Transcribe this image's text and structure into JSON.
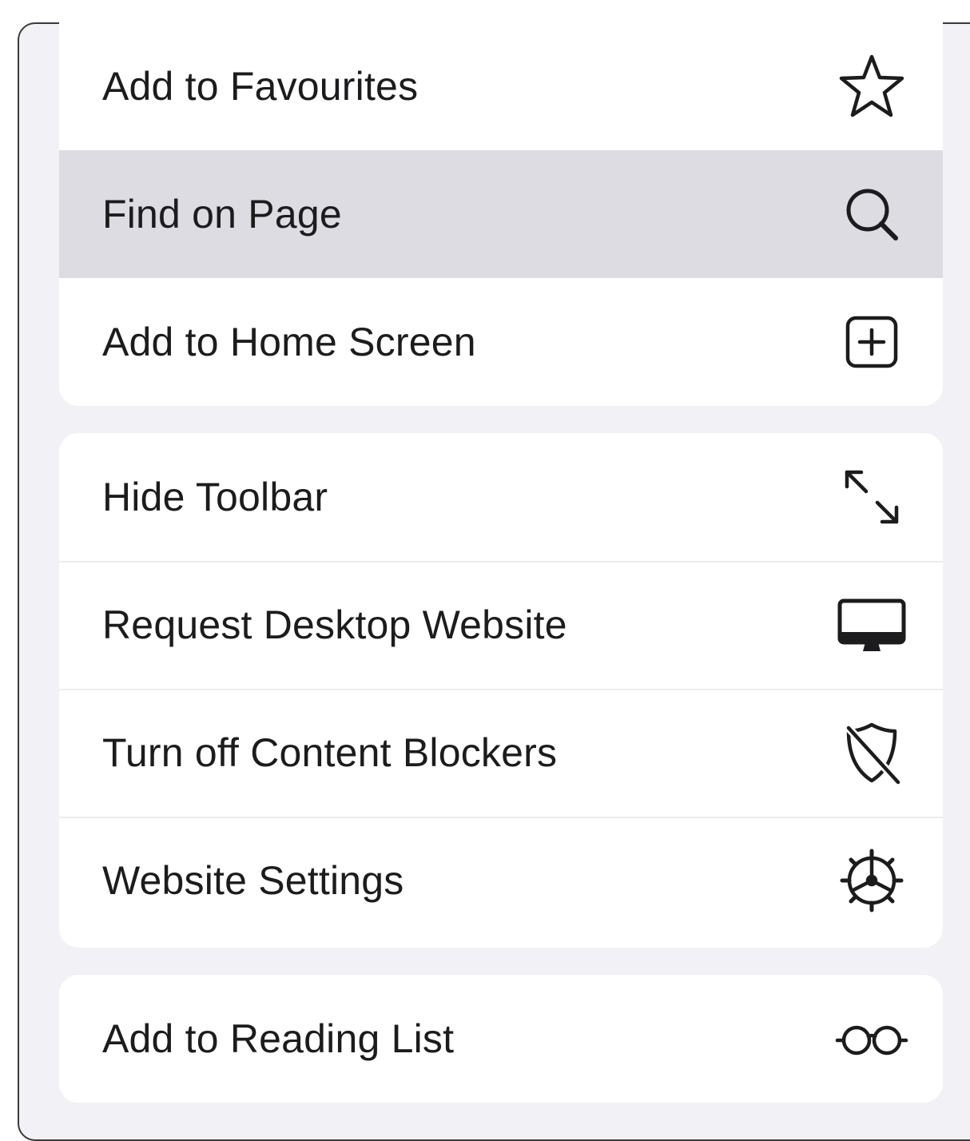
{
  "menu": {
    "groups": [
      {
        "items": [
          {
            "label": "Add to Favourites",
            "icon": "star-icon"
          },
          {
            "label": "Find on Page",
            "icon": "search-icon",
            "highlighted": true
          },
          {
            "label": "Add to Home Screen",
            "icon": "plus-square-icon"
          }
        ]
      },
      {
        "items": [
          {
            "label": "Hide Toolbar",
            "icon": "resize-arrows-icon"
          },
          {
            "label": "Request Desktop Website",
            "icon": "desktop-icon"
          },
          {
            "label": "Turn off Content Blockers",
            "icon": "shield-slash-icon"
          },
          {
            "label": "Website Settings",
            "icon": "gear-icon"
          }
        ]
      },
      {
        "items": [
          {
            "label": "Add to Reading List",
            "icon": "glasses-icon"
          }
        ]
      }
    ]
  },
  "colors": {
    "background": "#f2f1f6",
    "card": "#ffffff",
    "highlight": "#dddce2",
    "text": "#1c1c1e"
  }
}
